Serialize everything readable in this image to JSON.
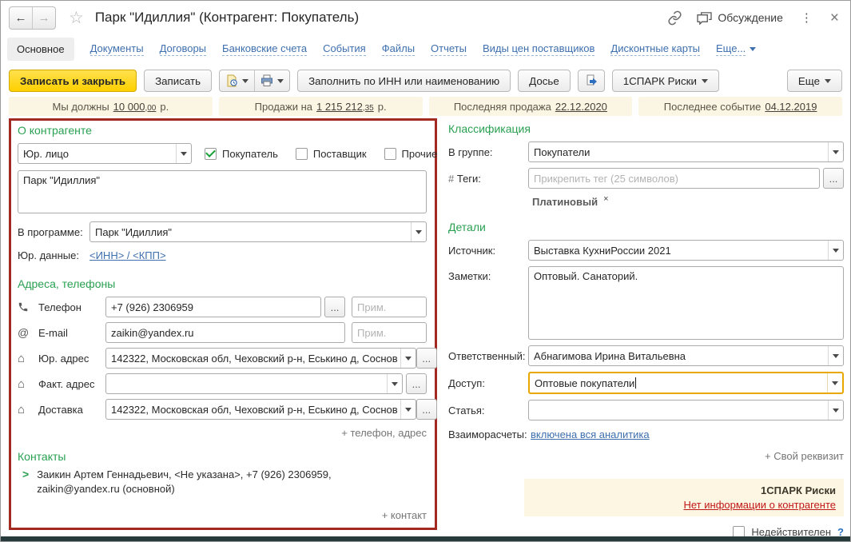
{
  "header": {
    "title": "Парк \"Идиллия\" (Контрагент: Покупатель)",
    "discussion": "Обсуждение"
  },
  "glyphs": {
    "back_arrow": "←",
    "forward_arrow": "→",
    "star": "☆",
    "kebab": "⋮",
    "close": "×",
    "house": "⌂",
    "at": "@",
    "chevron_right": ">",
    "ellipsis": "..."
  },
  "tabs": {
    "active": "Основное",
    "links": [
      "Документы",
      "Договоры",
      "Банковские счета",
      "События",
      "Файлы",
      "Отчеты",
      "Виды цен поставщиков",
      "Дисконтные карты"
    ],
    "more": "Еще..."
  },
  "toolbar": {
    "save_and_close": "Записать и закрыть",
    "save": "Записать",
    "fill_by_inn": "Заполнить по ИНН или наименованию",
    "dossier": "Досье",
    "spark_risks": "1СПАРК Риски",
    "more": "Еще"
  },
  "status_strip": {
    "we_owe_label": "Мы должны",
    "we_owe_value": "10 000",
    "we_owe_cents": ",00",
    "we_owe_currency": "р.",
    "sales_label": "Продажи на",
    "sales_value": "1 215 212",
    "sales_cents": ",35",
    "sales_currency": "р.",
    "last_sale_label": "Последняя продажа",
    "last_sale_value": "22.12.2020",
    "last_event_label": "Последнее событие",
    "last_event_value": "04.12.2019"
  },
  "about": {
    "section_title": "О контрагенте",
    "entity_type": "Юр. лицо",
    "checkbox_buyer": "Покупатель",
    "checkbox_supplier": "Поставщик",
    "checkbox_other": "Прочие",
    "name": "Парк \"Идиллия\"",
    "in_program_label": "В программе:",
    "in_program_value": "Парк \"Идиллия\"",
    "legal_data_label": "Юр. данные:",
    "legal_data_link": "<ИНН> / <КПП>"
  },
  "addresses": {
    "section_title": "Адреса, телефоны",
    "phone_label": "Телефон",
    "phone_value": "+7 (926) 2306959",
    "note_placeholder": "Прим.",
    "email_label": "E-mail",
    "email_value": "zaikin@yandex.ru",
    "legal_address_label": "Юр. адрес",
    "legal_address_value": "142322, Московская обл, Чеховский р-н, Еськино д, Соснов",
    "fact_address_label": "Факт. адрес",
    "fact_address_value": "",
    "delivery_label": "Доставка",
    "delivery_value": "142322, Московская обл, Чеховский р-н, Еськино д, Соснов",
    "add_link": "+ телефон, адрес"
  },
  "contacts": {
    "section_title": "Контакты",
    "contact_line": "Заикин Артем Геннадьевич, <Не указана>, +7 (926) 2306959, zaikin@yandex.ru (основной)",
    "add_link": "+ контакт"
  },
  "classification": {
    "section_title": "Классификация",
    "group_label": "В группе:",
    "group_value": "Покупатели",
    "tags_hash": "#",
    "tags_label": "Теги:",
    "tags_placeholder": "Прикрепить тег (25 символов)",
    "tag_chip": "Платиновый",
    "tag_remove": "×"
  },
  "details": {
    "section_title": "Детали",
    "source_label": "Источник:",
    "source_value": "Выставка КухниРоссии 2021",
    "notes_label": "Заметки:",
    "notes_value": "Оптовый. Санаторий.",
    "responsible_label": "Ответственный:",
    "responsible_value": "Абнагимова Ирина Витальевна",
    "access_label": "Доступ:",
    "access_value": "Оптовые покупатели",
    "article_label": "Статья:",
    "article_value": "",
    "settlements_label": "Взаиморасчеты:",
    "settlements_link": "включена вся аналитика",
    "add_attribute_link": "+ Свой реквизит"
  },
  "spark": {
    "title": "1СПАРК Риски",
    "no_info_link": "Нет информации о контрагенте"
  },
  "footer": {
    "invalid_label": "Недействителен",
    "help": "?"
  },
  "colors": {
    "accent_green": "#2aa052",
    "link_blue": "#3e6fae",
    "highlight_border_red": "#a22a21",
    "focus_border_yellow": "#e9a800",
    "primary_button_yellow": "#fed000",
    "status_strip_bg": "#fbf5e4",
    "error_red": "#c01818"
  }
}
